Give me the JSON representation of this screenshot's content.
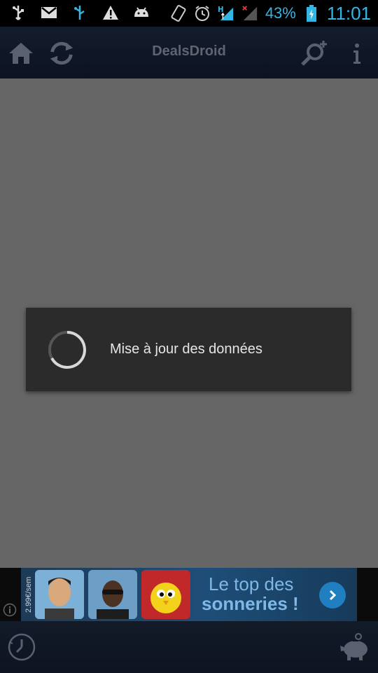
{
  "status_bar": {
    "battery": "43%",
    "time": "11:01",
    "icons_left": [
      "usb-icon",
      "gmail-icon",
      "usb-debug-icon",
      "warning-icon",
      "android-icon"
    ],
    "icons_right": [
      "rotate-icon",
      "alarm-icon",
      "data-hspa-icon",
      "signal-icon",
      "battery-icon"
    ]
  },
  "action_bar": {
    "title": "DealsDroid",
    "buttons": [
      "home-icon",
      "refresh-icon",
      "search-add-icon",
      "info-icon"
    ]
  },
  "dialog": {
    "message": "Mise à jour des données"
  },
  "ad": {
    "price": "2.99€/sem",
    "line1": "Le top des",
    "line2": "sonneries !"
  },
  "bottom_bar": {
    "buttons": [
      "clock-icon",
      "piggy-bank-icon"
    ]
  },
  "colors": {
    "accent": "#33b5e5",
    "dialog_bg": "#2b2b2b",
    "content_bg": "#666666"
  }
}
